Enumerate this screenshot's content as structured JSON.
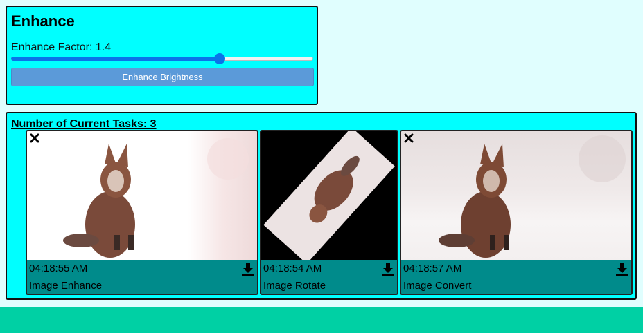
{
  "enhance": {
    "title": "Enhance",
    "factor_label": "Enhance Factor: 1.4",
    "factor_fraction": 0.69,
    "button_label": "Enhance Brightness"
  },
  "tasks": {
    "title": "Number of Current Tasks: 3",
    "items": [
      {
        "time": "04:18:55 AM",
        "label": "Image Enhance",
        "has_close": true
      },
      {
        "time": "04:18:54 AM",
        "label": "Image Rotate",
        "has_close": false
      },
      {
        "time": "04:18:57 AM",
        "label": "Image Convert",
        "has_close": true
      }
    ]
  },
  "icons": {
    "close": "close-icon",
    "download": "download-icon"
  },
  "colors": {
    "page_background": "#e0fefe",
    "panel_background": "#00ffff",
    "card_footer": "#008b8b",
    "slider_accent": "#0a74e8",
    "button": "#5b9ad9",
    "bottom_bar": "#00d0a4"
  }
}
